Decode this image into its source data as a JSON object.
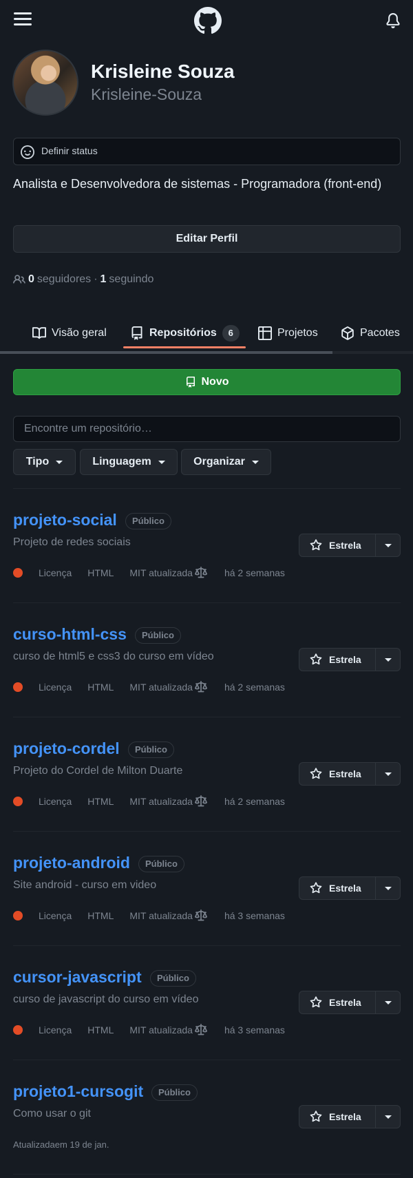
{
  "colors": {
    "background": "#161b22",
    "link": "#4493f8",
    "primary_button": "#238636",
    "language_html": "#e34c26",
    "tab_underline": "#f78166"
  },
  "icons": {
    "menu": "hamburger-icon",
    "logo": "github-logo-icon",
    "notifications": "bell-icon",
    "status": "smiley-icon",
    "people": "people-icon",
    "book": "book-icon",
    "repo": "repo-icon",
    "table": "table-icon",
    "package": "package-icon",
    "star": "star-icon",
    "law": "law-icon"
  },
  "profile": {
    "name": "Krisleine Souza",
    "login": "Krisleine-Souza",
    "status_label": "Definir status",
    "bio": "Analista e Desenvolvedora de sistemas - Programadora (front-end)",
    "edit_label": "Editar Perfil",
    "followers_count": "0",
    "followers_label": "seguidores",
    "separator": "·",
    "following_count": "1",
    "following_label": "seguindo"
  },
  "tabs": [
    {
      "label": "Visão geral"
    },
    {
      "label": "Repositórios",
      "count": "6"
    },
    {
      "label": "Projetos"
    },
    {
      "label": "Pacotes"
    }
  ],
  "toolbar": {
    "new_label": "Novo",
    "search_placeholder": "Encontre um repositório…",
    "filters": [
      "Tipo",
      "Linguagem",
      "Organizar"
    ]
  },
  "repos": [
    {
      "name": "projeto-social",
      "visibility": "Público",
      "description": "Projeto de redes sociais",
      "license": "Licença",
      "language": "HTML",
      "mit": "MIT atualizada",
      "updated": "há 2 semanas",
      "star": "Estrela"
    },
    {
      "name": "curso-html-css",
      "visibility": "Público",
      "description": "curso de html5 e css3 do curso em vídeo",
      "license": "Licença",
      "language": "HTML",
      "mit": "MIT atualizada",
      "updated": "há 2 semanas",
      "star": "Estrela"
    },
    {
      "name": "projeto-cordel",
      "visibility": "Público",
      "description": "Projeto do Cordel de Milton Duarte",
      "license": "Licença",
      "language": "HTML",
      "mit": "MIT atualizada",
      "updated": "há 2 semanas",
      "star": "Estrela"
    },
    {
      "name": "projeto-android",
      "visibility": "Público",
      "description": "Site android - curso em video",
      "license": "Licença",
      "language": "HTML",
      "mit": "MIT atualizada",
      "updated": "há 3 semanas",
      "star": "Estrela"
    },
    {
      "name": "cursor-javascript",
      "visibility": "Público",
      "description": "curso de javascript do curso em vídeo",
      "license": "Licença",
      "language": "HTML",
      "mit": "MIT atualizada",
      "updated": "há 3 semanas",
      "star": "Estrela"
    },
    {
      "name": "projeto1-cursogit",
      "visibility": "Público",
      "description": "Como usar o git",
      "updated_text": "Atualizadaem 19 de jan.",
      "star": "Estrela"
    }
  ]
}
